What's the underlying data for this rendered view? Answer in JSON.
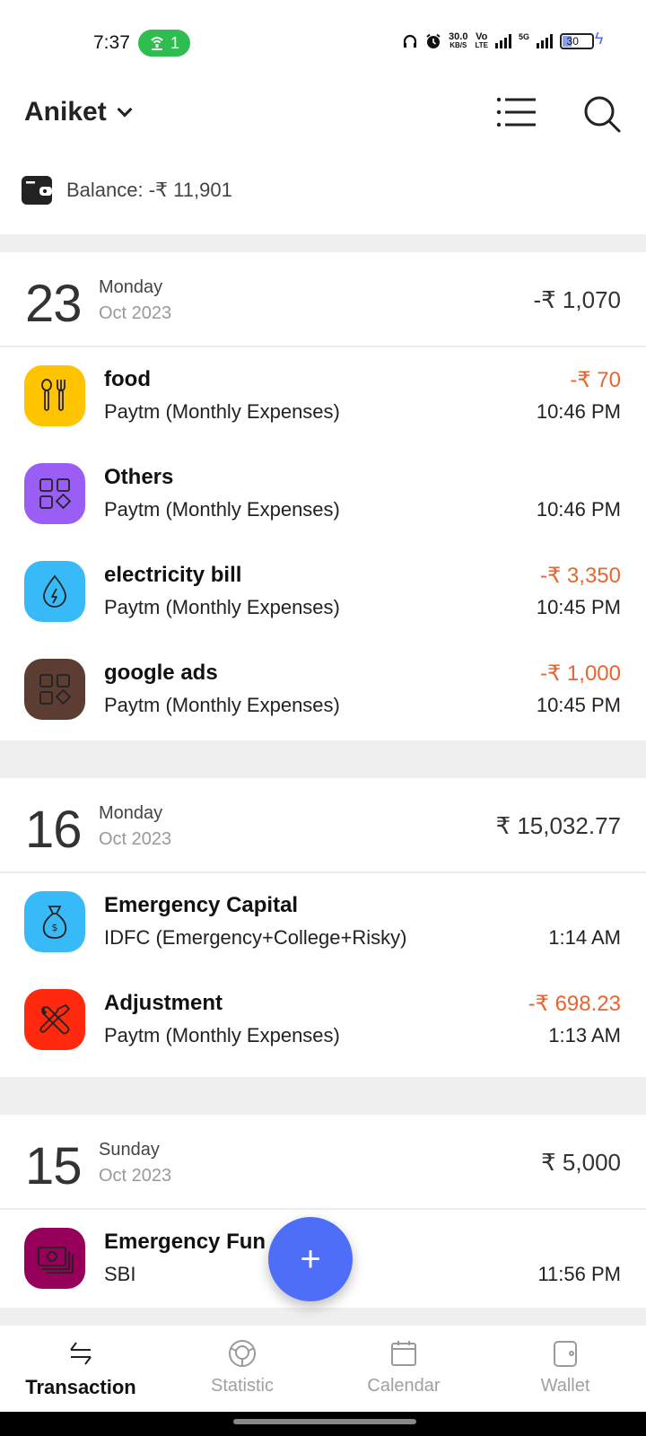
{
  "status_bar": {
    "time": "7:37",
    "hotspot_count": "1",
    "net_speed": "30.0",
    "net_speed_unit": "KB/S",
    "volte_top": "Vo",
    "volte_bottom": "LTE",
    "network_type": "5G",
    "battery": "30"
  },
  "header": {
    "account_name": "Aniket",
    "balance_label": "Balance: -₹ 11,901"
  },
  "day_groups": [
    {
      "day": "23",
      "weekday": "Monday",
      "month_year": "Oct 2023",
      "total": "-₹ 1,070",
      "transactions": [
        {
          "title": "food",
          "account": "Paytm (Monthly Expenses)",
          "amount": "-₹ 70",
          "time": "10:46 PM",
          "icon": "fork-spoon-icon",
          "color": "#ffc400"
        },
        {
          "title": "Others",
          "account": "Paytm (Monthly Expenses)",
          "amount": "",
          "time": "10:46 PM",
          "icon": "grid-shapes-icon",
          "color": "#9a5ef5"
        },
        {
          "title": "electricity bill",
          "account": "Paytm (Monthly Expenses)",
          "amount": "-₹ 3,350",
          "time": "10:45 PM",
          "icon": "energy-drop-icon",
          "color": "#38baf9"
        },
        {
          "title": "google ads",
          "account": "Paytm (Monthly Expenses)",
          "amount": "-₹ 1,000",
          "time": "10:45 PM",
          "icon": "grid-shapes-icon",
          "color": "#5b3d31"
        }
      ]
    },
    {
      "day": "16",
      "weekday": "Monday",
      "month_year": "Oct 2023",
      "total": "₹ 15,032.77",
      "transactions": [
        {
          "title": "Emergency Capital",
          "account": "IDFC (Emergency+College+Risky)",
          "amount": "",
          "time": "1:14 AM",
          "icon": "money-bag-icon",
          "color": "#38baf9"
        },
        {
          "title": "Adjustment",
          "account": "Paytm (Monthly Expenses)",
          "amount": "-₹ 698.23",
          "time": "1:13 AM",
          "icon": "tools-icon",
          "color": "#ff2a0e"
        }
      ]
    },
    {
      "day": "15",
      "weekday": "Sunday",
      "month_year": "Oct 2023",
      "total": "₹ 5,000",
      "transactions": [
        {
          "title": "Emergency Fun",
          "account": "SBI",
          "amount": "",
          "time": "11:56 PM",
          "icon": "cash-stack-icon",
          "color": "#96005a"
        }
      ]
    }
  ],
  "fab": {
    "label": "+"
  },
  "bottom_nav": [
    {
      "label": "Transaction",
      "active": true
    },
    {
      "label": "Statistic",
      "active": false
    },
    {
      "label": "Calendar",
      "active": false
    },
    {
      "label": "Wallet",
      "active": false
    }
  ],
  "colors": {
    "expense": "#e9642f",
    "accent": "#4f6ef7",
    "hotspot": "#2fbd4f"
  }
}
